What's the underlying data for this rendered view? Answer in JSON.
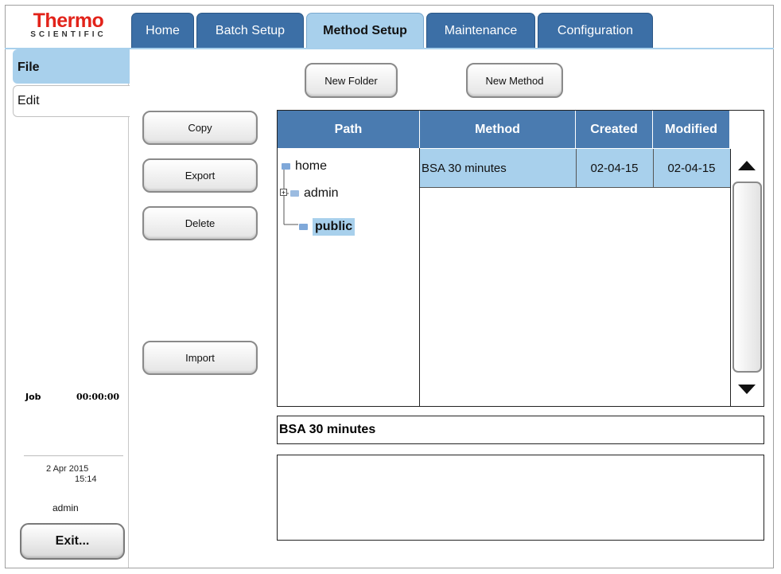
{
  "brand": {
    "line1": "Thermo",
    "line2": "SCIENTIFIC"
  },
  "tabs": [
    {
      "label": "Home",
      "active": false
    },
    {
      "label": "Batch Setup",
      "active": false
    },
    {
      "label": "Method Setup",
      "active": true
    },
    {
      "label": "Maintenance",
      "active": false
    },
    {
      "label": "Configuration",
      "active": false
    }
  ],
  "sidebar": {
    "items": [
      {
        "label": "File",
        "selected": true
      },
      {
        "label": "Edit",
        "selected": false
      }
    ],
    "job_label": "Job",
    "job_time": "00:00:00",
    "date": "2 Apr 2015",
    "time": "15:14",
    "user": "admin",
    "exit_label": "Exit..."
  },
  "toolbar": {
    "new_folder": "New Folder",
    "new_method": "New Method"
  },
  "actions": {
    "copy": "Copy",
    "export": "Export",
    "delete": "Delete",
    "import": "Import"
  },
  "table": {
    "headers": {
      "path": "Path",
      "method": "Method",
      "created": "Created",
      "modified": "Modified"
    },
    "tree": [
      {
        "label": "home",
        "level": 0
      },
      {
        "label": "admin",
        "level": 1,
        "expandable": true
      },
      {
        "label": "public",
        "level": 1,
        "selected": true
      }
    ],
    "rows": [
      {
        "method": "BSA 30 minutes",
        "created": "02-04-15",
        "modified": "02-04-15"
      }
    ]
  },
  "selected_method": "BSA 30 minutes",
  "description": "",
  "colors": {
    "tab": "#3c6fa6",
    "tab_active": "#a8d0ec",
    "header": "#4a7bb0",
    "selection": "#a8d0ec",
    "brand_red": "#e2231a"
  }
}
